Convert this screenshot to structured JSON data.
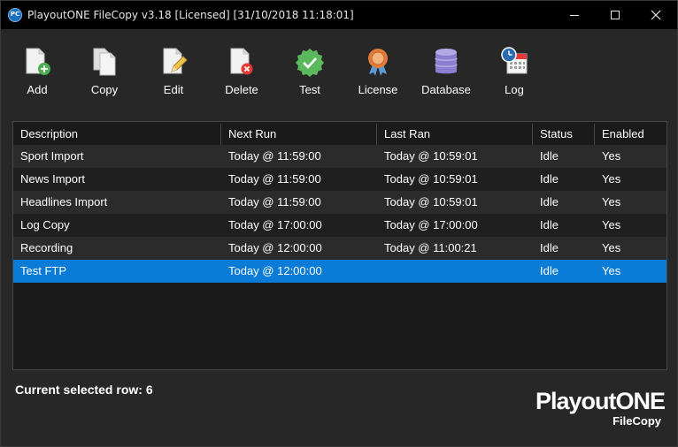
{
  "window": {
    "title": "PlayoutONE FileCopy v3.18 [Licensed] [31/10/2018 11:18:01]",
    "app_icon_text": "PC"
  },
  "toolbar": {
    "items": [
      {
        "label": "Add",
        "icon": "add-file-icon"
      },
      {
        "label": "Copy",
        "icon": "copy-files-icon"
      },
      {
        "label": "Edit",
        "icon": "edit-file-icon"
      },
      {
        "label": "Delete",
        "icon": "delete-file-icon"
      },
      {
        "label": "Test",
        "icon": "test-check-icon"
      },
      {
        "label": "License",
        "icon": "license-badge-icon"
      },
      {
        "label": "Database",
        "icon": "database-icon"
      },
      {
        "label": "Log",
        "icon": "log-calendar-icon"
      }
    ]
  },
  "grid": {
    "columns": [
      "Description",
      "Next Run",
      "Last Ran",
      "Status",
      "Enabled"
    ],
    "rows": [
      {
        "description": "Sport Import",
        "next_run": "Today @ 11:59:00",
        "last_ran": "Today @ 10:59:01",
        "status": "Idle",
        "enabled": "Yes"
      },
      {
        "description": "News Import",
        "next_run": "Today @ 11:59:00",
        "last_ran": "Today @ 10:59:01",
        "status": "Idle",
        "enabled": "Yes"
      },
      {
        "description": "Headlines Import",
        "next_run": "Today @ 11:59:00",
        "last_ran": "Today @ 10:59:01",
        "status": "Idle",
        "enabled": "Yes"
      },
      {
        "description": "Log Copy",
        "next_run": "Today @ 17:00:00",
        "last_ran": "Today @ 17:00:00",
        "status": "Idle",
        "enabled": "Yes"
      },
      {
        "description": "Recording",
        "next_run": "Today @ 12:00:00",
        "last_ran": "Today @ 11:00:21",
        "status": "Idle",
        "enabled": "Yes"
      },
      {
        "description": "Test FTP",
        "next_run": "Today @ 12:00:00",
        "last_ran": "",
        "status": "Idle",
        "enabled": "Yes"
      }
    ],
    "selected_index": 5
  },
  "footer": {
    "status_text": "Current selected row: 6",
    "brand_main": "PlayoutONE",
    "brand_sub": "FileCopy"
  },
  "colors": {
    "selection": "#0a7bd6",
    "title_bar": "#000000",
    "background": "#272727",
    "grid_background": "#1a1a1a",
    "add_green": "#4caf50",
    "delete_red": "#e53935",
    "test_green": "#5cb85c",
    "license_orange": "#e07b39",
    "database_purple": "#9c8fd6",
    "log_blue": "#2b6cb0"
  }
}
